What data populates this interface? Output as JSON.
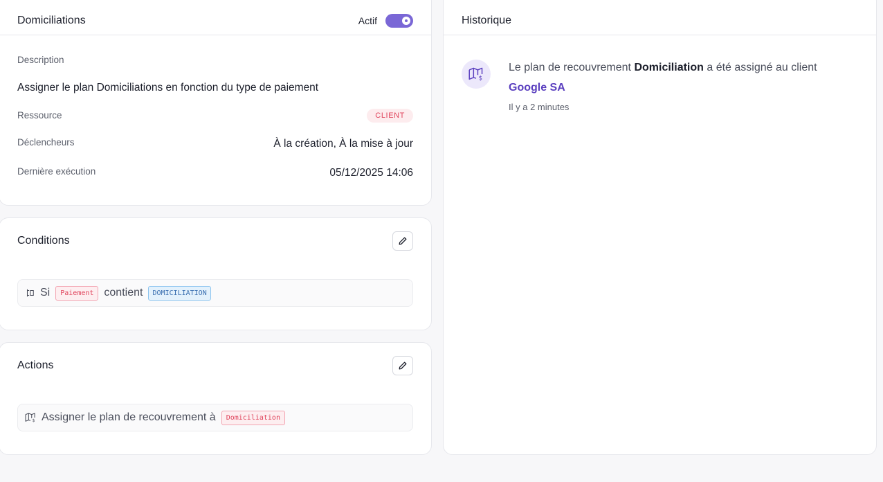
{
  "automation": {
    "title": "Domiciliations",
    "active_label": "Actif",
    "active": true,
    "description_label": "Description",
    "description": "Assigner le plan Domiciliations en fonction du type de paiement",
    "resource_label": "Ressource",
    "resource_badge": "CLIENT",
    "triggers_label": "Déclencheurs",
    "triggers": "À la création, À la mise à jour",
    "last_run_label": "Dernière exécution",
    "last_run": "05/12/2025 14:06"
  },
  "conditions": {
    "title": "Conditions",
    "if_word": "Si",
    "field_chip": "Paiement",
    "operator": "contient",
    "value_chip": "DOMICILIATION"
  },
  "actions": {
    "title": "Actions",
    "text": "Assigner le plan de recouvrement à",
    "plan_chip": "Domiciliation"
  },
  "history": {
    "title": "Historique",
    "entry": {
      "prefix": "Le plan de recouvrement",
      "plan": "Domiciliation",
      "suffix": "a été assigné au client",
      "client": "Google SA",
      "time": "Il y a 2 minutes"
    }
  },
  "colors": {
    "accent": "#7a67d6",
    "client_link": "#5a3fbf",
    "badge_red": "#e0445c",
    "chip_blue": "#3a6fb0"
  },
  "icons": {
    "condition": "branch-icon",
    "action": "map-dollar-icon",
    "history": "map-dollar-icon",
    "edit": "pencil-icon"
  }
}
